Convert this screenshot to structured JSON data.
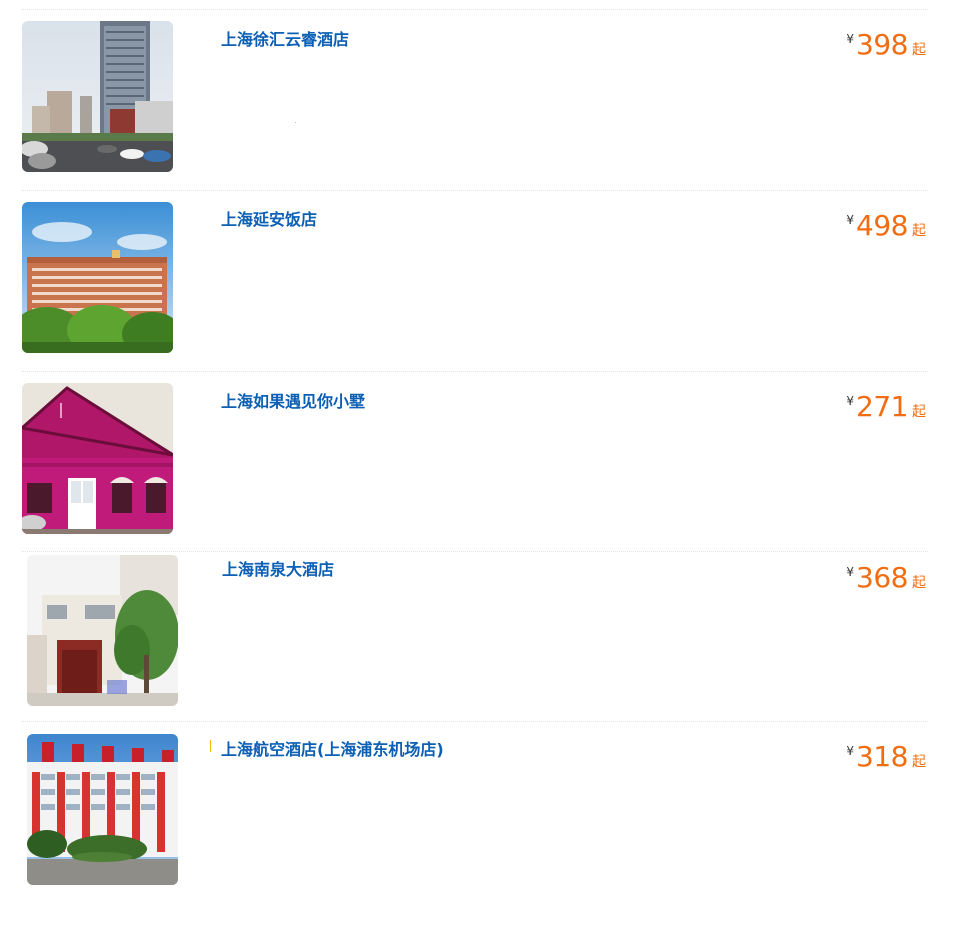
{
  "hotels": [
    {
      "name": "上海徐汇云睿酒店",
      "currency": "¥",
      "price": "398",
      "price_suffix": "起",
      "image_icon": "hotel-tower-photo"
    },
    {
      "name": "上海延安饭店",
      "currency": "¥",
      "price": "498",
      "price_suffix": "起",
      "image_icon": "hotel-building-trees-photo"
    },
    {
      "name": "上海如果遇见你小墅",
      "currency": "¥",
      "price": "271",
      "price_suffix": "起",
      "image_icon": "pink-villa-photo"
    },
    {
      "name": "上海南泉大酒店",
      "currency": "¥",
      "price": "368",
      "price_suffix": "起",
      "image_icon": "hotel-facade-tree-photo"
    },
    {
      "name": "上海航空酒店(上海浦东机场店)",
      "currency": "¥",
      "price": "318",
      "price_suffix": "起",
      "image_icon": "airport-hotel-photo"
    }
  ],
  "colors": {
    "name_link": "#0b5fb5",
    "price": "#f26d12",
    "currency": "#333333",
    "divider": "#e6e6e6"
  }
}
